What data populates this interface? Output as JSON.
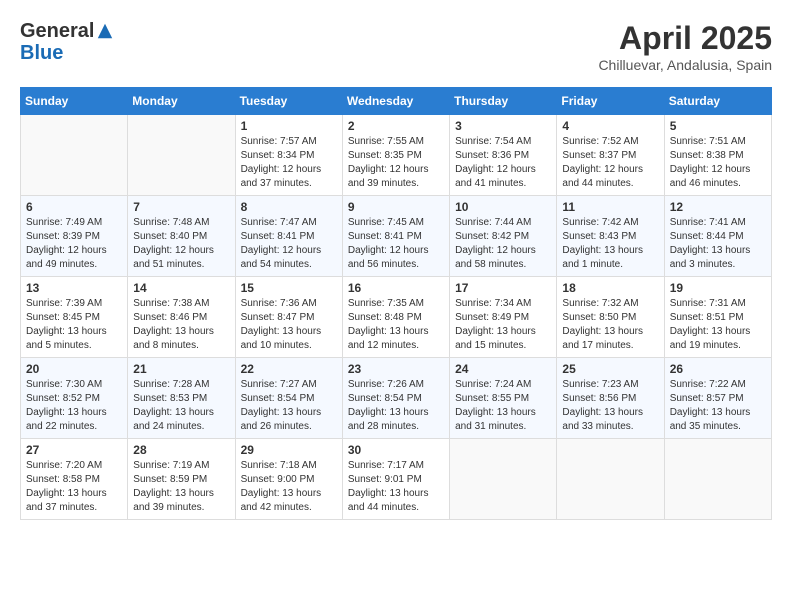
{
  "header": {
    "logo_general": "General",
    "logo_blue": "Blue",
    "month_title": "April 2025",
    "location": "Chilluevar, Andalusia, Spain"
  },
  "weekdays": [
    "Sunday",
    "Monday",
    "Tuesday",
    "Wednesday",
    "Thursday",
    "Friday",
    "Saturday"
  ],
  "weeks": [
    [
      {
        "day": "",
        "info": ""
      },
      {
        "day": "",
        "info": ""
      },
      {
        "day": "1",
        "info": "Sunrise: 7:57 AM\nSunset: 8:34 PM\nDaylight: 12 hours and 37 minutes."
      },
      {
        "day": "2",
        "info": "Sunrise: 7:55 AM\nSunset: 8:35 PM\nDaylight: 12 hours and 39 minutes."
      },
      {
        "day": "3",
        "info": "Sunrise: 7:54 AM\nSunset: 8:36 PM\nDaylight: 12 hours and 41 minutes."
      },
      {
        "day": "4",
        "info": "Sunrise: 7:52 AM\nSunset: 8:37 PM\nDaylight: 12 hours and 44 minutes."
      },
      {
        "day": "5",
        "info": "Sunrise: 7:51 AM\nSunset: 8:38 PM\nDaylight: 12 hours and 46 minutes."
      }
    ],
    [
      {
        "day": "6",
        "info": "Sunrise: 7:49 AM\nSunset: 8:39 PM\nDaylight: 12 hours and 49 minutes."
      },
      {
        "day": "7",
        "info": "Sunrise: 7:48 AM\nSunset: 8:40 PM\nDaylight: 12 hours and 51 minutes."
      },
      {
        "day": "8",
        "info": "Sunrise: 7:47 AM\nSunset: 8:41 PM\nDaylight: 12 hours and 54 minutes."
      },
      {
        "day": "9",
        "info": "Sunrise: 7:45 AM\nSunset: 8:41 PM\nDaylight: 12 hours and 56 minutes."
      },
      {
        "day": "10",
        "info": "Sunrise: 7:44 AM\nSunset: 8:42 PM\nDaylight: 12 hours and 58 minutes."
      },
      {
        "day": "11",
        "info": "Sunrise: 7:42 AM\nSunset: 8:43 PM\nDaylight: 13 hours and 1 minute."
      },
      {
        "day": "12",
        "info": "Sunrise: 7:41 AM\nSunset: 8:44 PM\nDaylight: 13 hours and 3 minutes."
      }
    ],
    [
      {
        "day": "13",
        "info": "Sunrise: 7:39 AM\nSunset: 8:45 PM\nDaylight: 13 hours and 5 minutes."
      },
      {
        "day": "14",
        "info": "Sunrise: 7:38 AM\nSunset: 8:46 PM\nDaylight: 13 hours and 8 minutes."
      },
      {
        "day": "15",
        "info": "Sunrise: 7:36 AM\nSunset: 8:47 PM\nDaylight: 13 hours and 10 minutes."
      },
      {
        "day": "16",
        "info": "Sunrise: 7:35 AM\nSunset: 8:48 PM\nDaylight: 13 hours and 12 minutes."
      },
      {
        "day": "17",
        "info": "Sunrise: 7:34 AM\nSunset: 8:49 PM\nDaylight: 13 hours and 15 minutes."
      },
      {
        "day": "18",
        "info": "Sunrise: 7:32 AM\nSunset: 8:50 PM\nDaylight: 13 hours and 17 minutes."
      },
      {
        "day": "19",
        "info": "Sunrise: 7:31 AM\nSunset: 8:51 PM\nDaylight: 13 hours and 19 minutes."
      }
    ],
    [
      {
        "day": "20",
        "info": "Sunrise: 7:30 AM\nSunset: 8:52 PM\nDaylight: 13 hours and 22 minutes."
      },
      {
        "day": "21",
        "info": "Sunrise: 7:28 AM\nSunset: 8:53 PM\nDaylight: 13 hours and 24 minutes."
      },
      {
        "day": "22",
        "info": "Sunrise: 7:27 AM\nSunset: 8:54 PM\nDaylight: 13 hours and 26 minutes."
      },
      {
        "day": "23",
        "info": "Sunrise: 7:26 AM\nSunset: 8:54 PM\nDaylight: 13 hours and 28 minutes."
      },
      {
        "day": "24",
        "info": "Sunrise: 7:24 AM\nSunset: 8:55 PM\nDaylight: 13 hours and 31 minutes."
      },
      {
        "day": "25",
        "info": "Sunrise: 7:23 AM\nSunset: 8:56 PM\nDaylight: 13 hours and 33 minutes."
      },
      {
        "day": "26",
        "info": "Sunrise: 7:22 AM\nSunset: 8:57 PM\nDaylight: 13 hours and 35 minutes."
      }
    ],
    [
      {
        "day": "27",
        "info": "Sunrise: 7:20 AM\nSunset: 8:58 PM\nDaylight: 13 hours and 37 minutes."
      },
      {
        "day": "28",
        "info": "Sunrise: 7:19 AM\nSunset: 8:59 PM\nDaylight: 13 hours and 39 minutes."
      },
      {
        "day": "29",
        "info": "Sunrise: 7:18 AM\nSunset: 9:00 PM\nDaylight: 13 hours and 42 minutes."
      },
      {
        "day": "30",
        "info": "Sunrise: 7:17 AM\nSunset: 9:01 PM\nDaylight: 13 hours and 44 minutes."
      },
      {
        "day": "",
        "info": ""
      },
      {
        "day": "",
        "info": ""
      },
      {
        "day": "",
        "info": ""
      }
    ]
  ]
}
